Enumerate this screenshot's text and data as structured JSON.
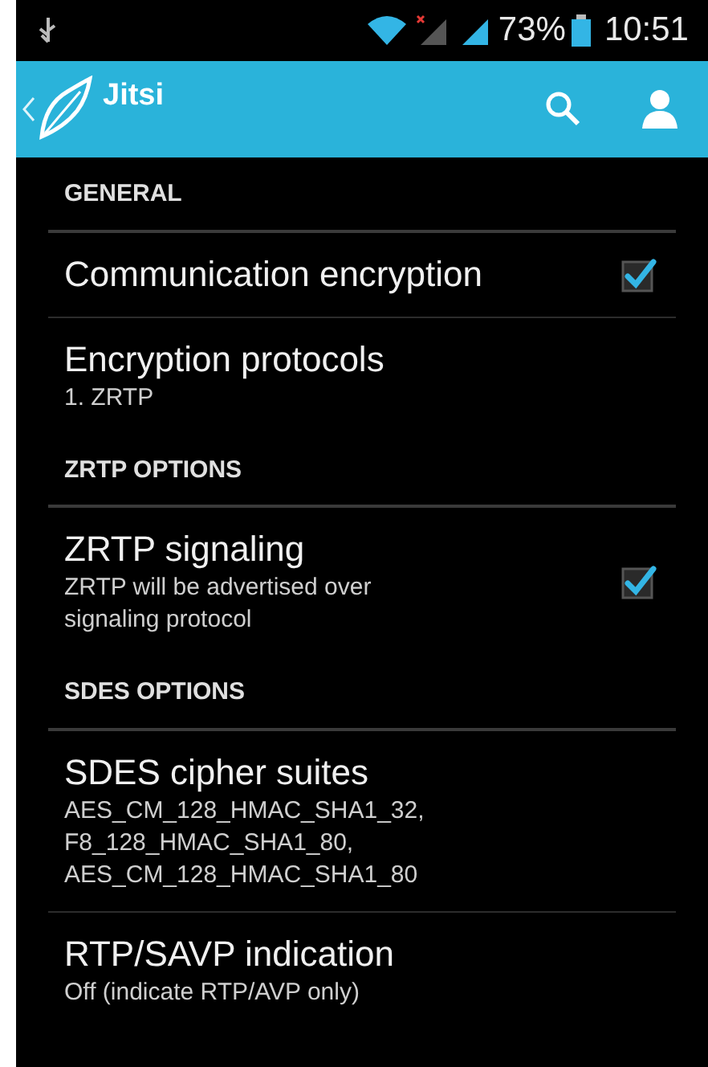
{
  "status_bar": {
    "battery": "73%",
    "time": "10:51"
  },
  "action_bar": {
    "title": "Jitsi"
  },
  "items": [
    {
      "kind": "header",
      "title": "GENERAL"
    },
    {
      "kind": "preference",
      "title": "Communication encryption",
      "checked": true,
      "divider": true
    },
    {
      "kind": "preference",
      "title": "Encryption protocols",
      "summary": "1. ZRTP",
      "divider": false
    },
    {
      "kind": "header",
      "title": "ZRTP OPTIONS"
    },
    {
      "kind": "preference",
      "title": "ZRTP signaling",
      "summary": "ZRTP will be advertised over signaling protocol",
      "checked": true,
      "divider": false
    },
    {
      "kind": "header",
      "title": "SDES OPTIONS"
    },
    {
      "kind": "preference",
      "title": "SDES cipher suites",
      "summary": "AES_CM_128_HMAC_SHA1_32,\nF8_128_HMAC_SHA1_80,\nAES_CM_128_HMAC_SHA1_80",
      "divider": true
    },
    {
      "kind": "preference",
      "title": "RTP/SAVP indication",
      "summary": "Off (indicate RTP/AVP only)",
      "divider": false
    }
  ]
}
